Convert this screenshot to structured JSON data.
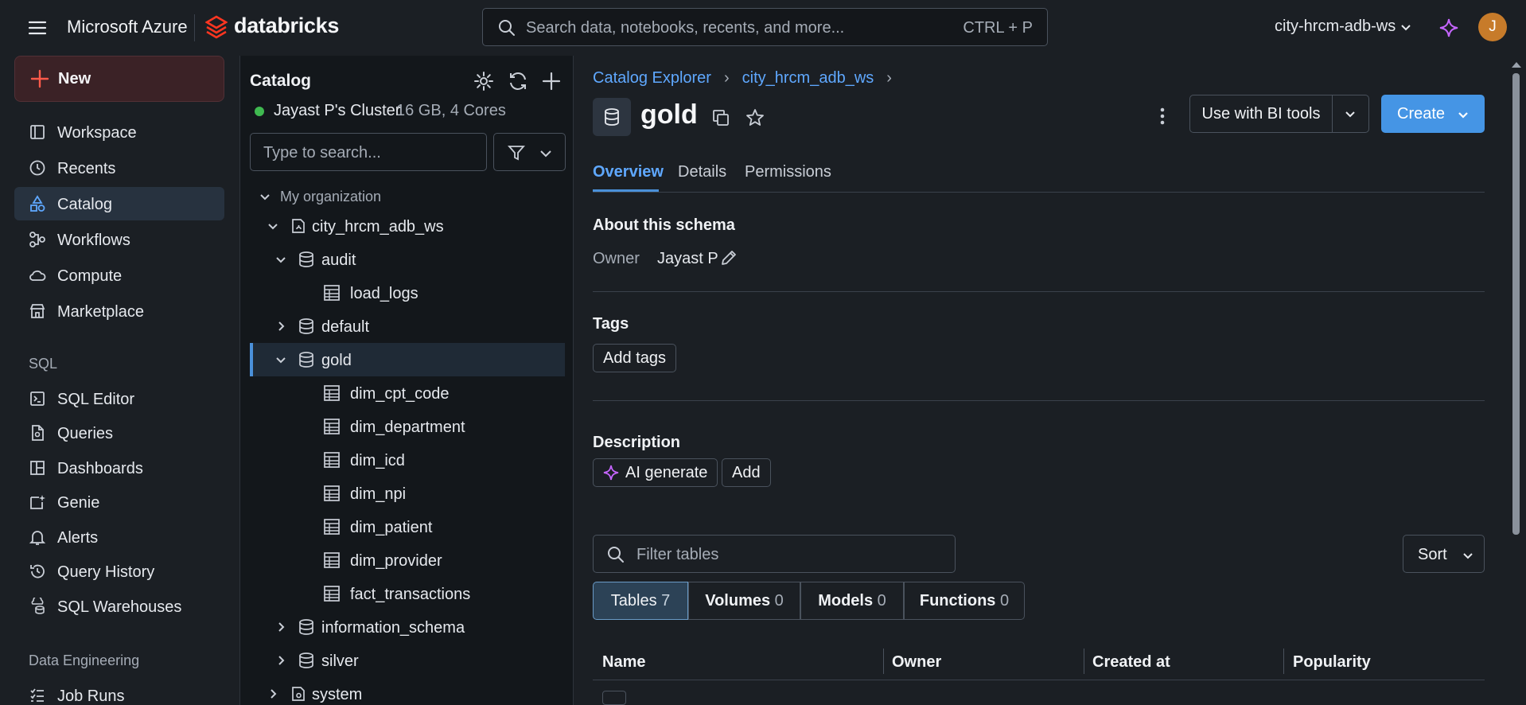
{
  "header": {
    "brand": "Microsoft Azure",
    "product": "databricks",
    "search_placeholder": "Search data, notebooks, recents, and more...",
    "search_shortcut": "CTRL + P",
    "workspace": "city-hrcm-adb-ws",
    "avatar_initial": "J"
  },
  "sidebar": {
    "new_label": "New",
    "items": [
      {
        "label": "Workspace",
        "icon": "workspace-icon"
      },
      {
        "label": "Recents",
        "icon": "clock-icon"
      },
      {
        "label": "Catalog",
        "icon": "catalog-icon",
        "active": true
      },
      {
        "label": "Workflows",
        "icon": "workflows-icon"
      },
      {
        "label": "Compute",
        "icon": "cloud-icon"
      },
      {
        "label": "Marketplace",
        "icon": "store-icon"
      }
    ],
    "sql_section": "SQL",
    "sql_items": [
      {
        "label": "SQL Editor",
        "icon": "sql-editor-icon"
      },
      {
        "label": "Queries",
        "icon": "query-file-icon"
      },
      {
        "label": "Dashboards",
        "icon": "dashboard-icon"
      },
      {
        "label": "Genie",
        "icon": "genie-icon"
      },
      {
        "label": "Alerts",
        "icon": "bell-icon"
      },
      {
        "label": "Query History",
        "icon": "history-icon"
      },
      {
        "label": "SQL Warehouses",
        "icon": "warehouse-icon"
      }
    ],
    "de_section": "Data Engineering",
    "de_items": [
      {
        "label": "Job Runs",
        "icon": "job-runs-icon"
      }
    ]
  },
  "catalog_panel": {
    "title": "Catalog",
    "cluster_name": "Jayast P's Cluster",
    "cluster_spec": "16 GB, 4 Cores",
    "search_placeholder": "Type to search...",
    "tree": [
      {
        "label": "My organization",
        "type": "org"
      },
      {
        "label": "city_hrcm_adb_ws",
        "type": "catalog"
      },
      {
        "label": "audit",
        "type": "schema"
      },
      {
        "label": "load_logs",
        "type": "table"
      },
      {
        "label": "default",
        "type": "schema"
      },
      {
        "label": "gold",
        "type": "schema",
        "selected": true
      },
      {
        "label": "dim_cpt_code",
        "type": "table"
      },
      {
        "label": "dim_department",
        "type": "table"
      },
      {
        "label": "dim_icd",
        "type": "table"
      },
      {
        "label": "dim_npi",
        "type": "table"
      },
      {
        "label": "dim_patient",
        "type": "table"
      },
      {
        "label": "dim_provider",
        "type": "table"
      },
      {
        "label": "fact_transactions",
        "type": "table"
      },
      {
        "label": "information_schema",
        "type": "schema"
      },
      {
        "label": "silver",
        "type": "schema"
      },
      {
        "label": "system",
        "type": "catalog"
      }
    ]
  },
  "main": {
    "breadcrumb": [
      "Catalog Explorer",
      "city_hrcm_adb_ws"
    ],
    "breadcrumb_sep": "›",
    "title": "gold",
    "bi_tools_label": "Use with BI tools",
    "create_label": "Create",
    "tabs": [
      "Overview",
      "Details",
      "Permissions"
    ],
    "about_heading": "About this schema",
    "owner_label": "Owner",
    "owner_value": "Jayast P",
    "tags_heading": "Tags",
    "add_tags_label": "Add tags",
    "description_heading": "Description",
    "ai_generate_label": "AI generate",
    "add_label": "Add",
    "filter_placeholder": "Filter tables",
    "sort_label": "Sort",
    "segments": [
      {
        "label": "Tables",
        "count": "7",
        "active": true
      },
      {
        "label": "Volumes",
        "count": "0"
      },
      {
        "label": "Models",
        "count": "0"
      },
      {
        "label": "Functions",
        "count": "0"
      }
    ],
    "columns": [
      "Name",
      "Owner",
      "Created at",
      "Popularity"
    ]
  },
  "colors": {
    "accent": "#4595e5",
    "link": "#5fa8ff",
    "brand_red": "#ff3621",
    "cluster_status": "#3fb950"
  }
}
